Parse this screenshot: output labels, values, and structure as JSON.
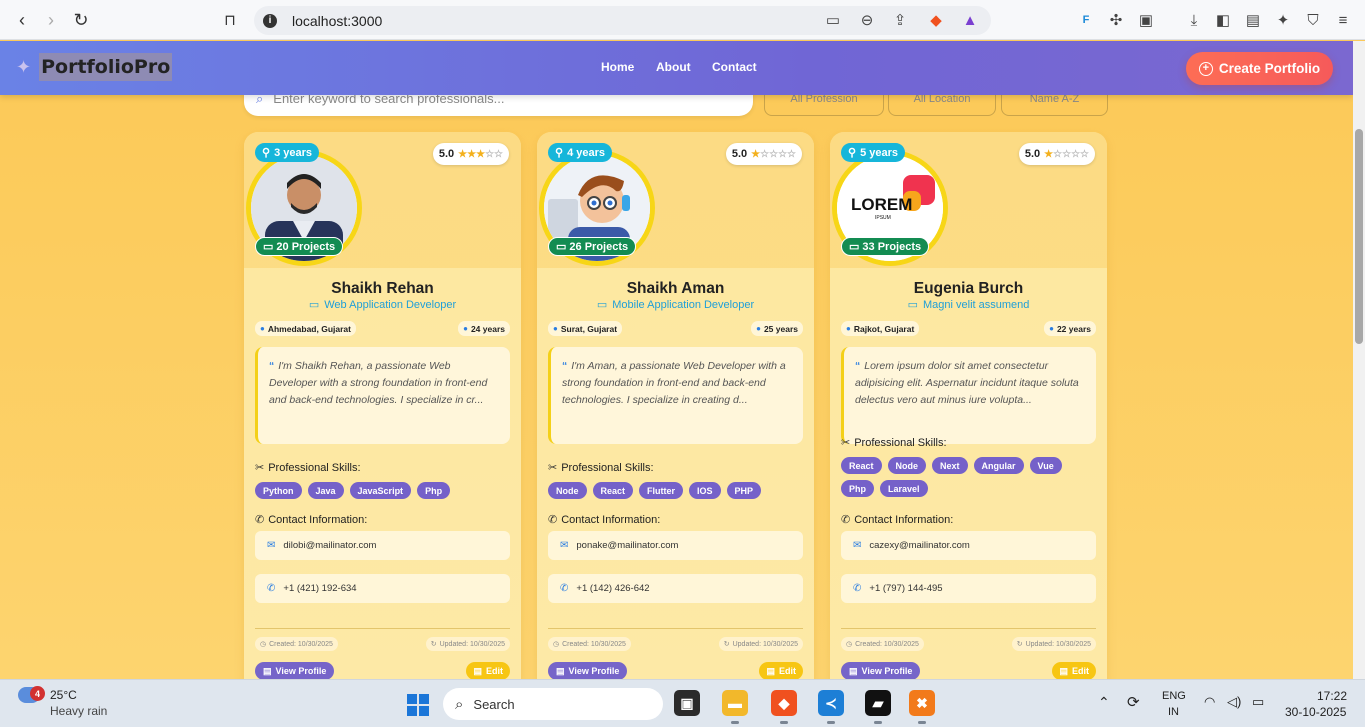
{
  "browser": {
    "url": "localhost:3000"
  },
  "header": {
    "logo": "PortfolioPro",
    "nav": [
      "Home",
      "About",
      "Contact"
    ],
    "create_label": "Create Portfolio"
  },
  "search": {
    "placeholder": "Enter keyword to search professionals...",
    "filters": [
      "All Profession",
      "All Location",
      "Name A-Z"
    ]
  },
  "cards": [
    {
      "experience": "3 years",
      "rating": "5.0",
      "stars": 3,
      "projects": "20 Projects",
      "name": "Shaikh Rehan",
      "role": "Web Application Developer",
      "location": "Ahmedabad, Gujarat",
      "age": "24 years",
      "bio": "I'm Shaikh Rehan, a passionate Web Developer with a strong foundation in front-end and back-end technologies. I specialize in cr...",
      "skills_label": "Professional Skills:",
      "skills": [
        "Python",
        "Java",
        "JavaScript",
        "Php"
      ],
      "contact_label": "Contact Information:",
      "email": "dilobi@mailinator.com",
      "phone": "+1 (421) 192-634",
      "created": "Created: 10/30/2025",
      "updated": "Updated: 10/30/2025",
      "view": "View Profile",
      "edit": "Edit",
      "avatar": "man-photo"
    },
    {
      "experience": "4 years",
      "rating": "5.0",
      "stars": 1,
      "projects": "26 Projects",
      "name": "Shaikh Aman",
      "role": "Mobile Application Developer",
      "location": "Surat, Gujarat",
      "age": "25 years",
      "bio": "I'm Aman, a passionate Web Developer with a strong foundation in front-end and back-end technologies. I specialize in creating d...",
      "skills_label": "Professional Skills:",
      "skills": [
        "Node",
        "React",
        "Flutter",
        "IOS",
        "PHP"
      ],
      "contact_label": "Contact Information:",
      "email": "ponake@mailinator.com",
      "phone": "+1 (142) 426-642",
      "created": "Created: 10/30/2025",
      "updated": "Updated: 10/30/2025",
      "view": "View Profile",
      "edit": "Edit",
      "avatar": "cartoon-developer"
    },
    {
      "experience": "5 years",
      "rating": "5.0",
      "stars": 1,
      "projects": "33 Projects",
      "name": "Eugenia Burch",
      "role": "Magni velit assumend",
      "location": "Rajkot, Gujarat",
      "age": "22 years",
      "bio": "Lorem ipsum dolor sit amet consectetur adipisicing elit. Aspernatur incidunt itaque soluta delectus vero aut minus iure volupta...",
      "skills_label": "Professional Skills:",
      "skills": [
        "React",
        "Node",
        "Next",
        "Angular",
        "Vue",
        "Php",
        "Laravel"
      ],
      "contact_label": "Contact Information:",
      "email": "cazexy@mailinator.com",
      "phone": "+1 (797) 144-495",
      "created": "Created: 10/30/2025",
      "updated": "Updated: 10/30/2025",
      "view": "View Profile",
      "edit": "Edit",
      "avatar": "lorem-ipsum-logo"
    }
  ],
  "taskbar": {
    "weather_badge": "4",
    "temp": "25°C",
    "condition": "Heavy rain",
    "search": "Search",
    "lang1": "ENG",
    "lang2": "IN",
    "time": "17:22",
    "date": "30-10-2025"
  },
  "colors": {
    "header_start": "#6a82e6",
    "header_end": "#7b68d0",
    "accent_create": "#fd6d55",
    "skill_chip": "#7561c9",
    "project_badge": "#138c52",
    "experience_badge": "#16b6da"
  }
}
